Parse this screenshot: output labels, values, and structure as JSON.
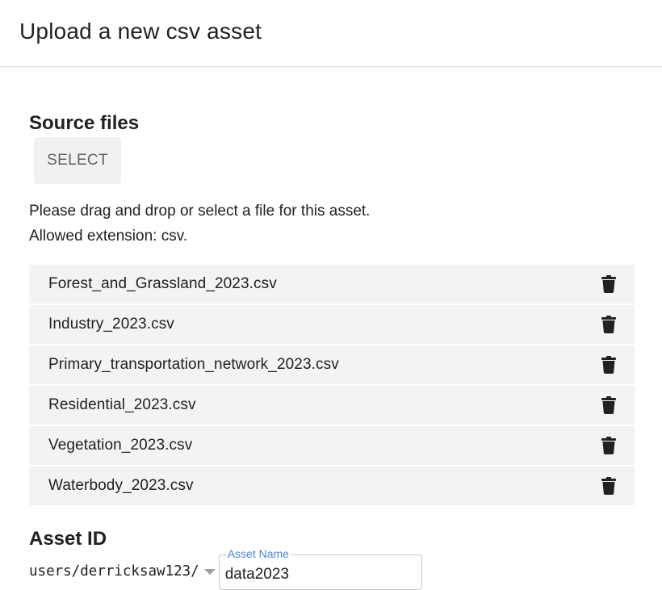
{
  "dialog": {
    "title": "Upload a new csv asset"
  },
  "source": {
    "heading": "Source files",
    "select_label": "SELECT",
    "help_line1": "Please drag and drop or select a file for this asset.",
    "help_line2": "Allowed extension: csv."
  },
  "files": [
    {
      "name": "Forest_and_Grassland_2023.csv"
    },
    {
      "name": "Industry_2023.csv"
    },
    {
      "name": "Primary_transportation_network_2023.csv"
    },
    {
      "name": "Residential_2023.csv"
    },
    {
      "name": "Vegetation_2023.csv"
    },
    {
      "name": "Waterbody_2023.csv"
    }
  ],
  "asset": {
    "heading": "Asset ID",
    "prefix": "users/derricksaw123/",
    "name_label": "Asset Name",
    "name_value": "data2023"
  },
  "colors": {
    "row_background": "#f3f3f3",
    "button_background": "#f1f1f1",
    "field_label": "#4a86d4"
  }
}
